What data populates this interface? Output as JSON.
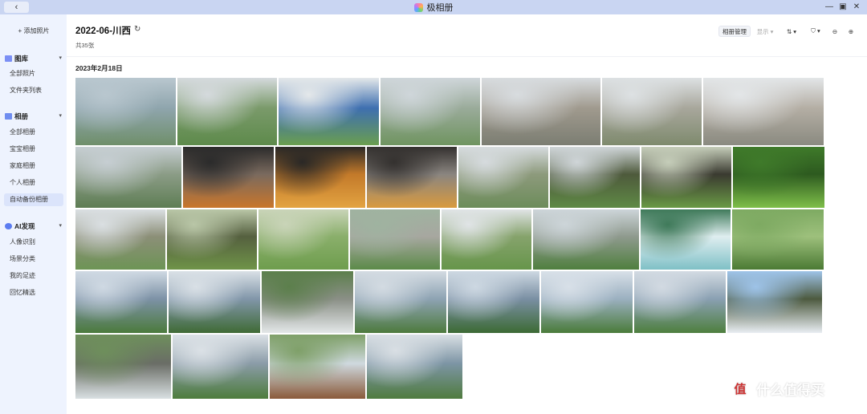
{
  "window": {
    "title": "极相册",
    "back_label": "‹",
    "controls": [
      "—",
      "▣",
      "✕"
    ]
  },
  "sidebar": {
    "add_photo": "+ 添加照片",
    "library": {
      "title": "图库",
      "items": [
        "全部照片",
        "文件夹列表"
      ]
    },
    "albums": {
      "title": "相册",
      "items": [
        "全部相册",
        "宝宝相册",
        "家庭相册",
        "个人相册",
        "自动备份相册"
      ],
      "active_index": 4
    },
    "ai": {
      "title": "AI发现",
      "items": [
        "人像识别",
        "场景分类",
        "我的足迹",
        "回忆精选"
      ]
    },
    "colors": {
      "accent": "#5b7cf0",
      "active_bg": "#dbe4fb"
    }
  },
  "header": {
    "album_title": "2022-06-川西",
    "photo_count": "共35张",
    "toolbar": {
      "manage": "相册管理",
      "display": "显示 ▾",
      "sort": "⇅ ▾",
      "filter": "⛉ ▾",
      "zoom_out": "⊖",
      "zoom_in": "⊕"
    }
  },
  "date_group": "2023年2月18日",
  "photos": [
    {
      "scene": "hydropower station under misty mountains by a lake",
      "colors": [
        "#b9c7cf",
        "#6f8f6a",
        "#8fa5ad"
      ]
    },
    {
      "scene": "green valley with village and clouds",
      "colors": [
        "#d5dadd",
        "#5d8a4b",
        "#7a9a6a"
      ]
    },
    {
      "scene": "meadow with blue signboard",
      "colors": [
        "#e4e8ea",
        "#6a9e4f",
        "#3e6fb0"
      ]
    },
    {
      "scene": "valley road and river with low clouds",
      "colors": [
        "#cfd6da",
        "#6f9460",
        "#9aab9a"
      ]
    },
    {
      "scene": "mountain ridges with swirling clouds",
      "colors": [
        "#d8dcdf",
        "#7b7d72",
        "#a09a8e"
      ]
    },
    {
      "scene": "winding mountain road in mist",
      "colors": [
        "#dde1e3",
        "#7e8a6d",
        "#a8a79c"
      ]
    },
    {
      "scene": "snow dusted peaks above clouds",
      "colors": [
        "#e3e6e8",
        "#8a8a80",
        "#b4aea4"
      ]
    },
    {
      "scene": "deep valley with cloud bank",
      "colors": [
        "#c6ced2",
        "#5e7d54",
        "#8b9c86"
      ]
    },
    {
      "scene": "grilled meat skewers on a grill",
      "colors": [
        "#2b2b2b",
        "#c9762b",
        "#7a6a5e"
      ]
    },
    {
      "scene": "fried potato skewers",
      "colors": [
        "#2a2826",
        "#e3a341",
        "#c37a2a"
      ]
    },
    {
      "scene": "skewers with fried dough",
      "colors": [
        "#34312f",
        "#d99a3e",
        "#8a8580"
      ]
    },
    {
      "scene": "grassy hillside under cloudy sky",
      "colors": [
        "#d6dbde",
        "#6c8c5a",
        "#8d9a7c"
      ]
    },
    {
      "scene": "yaks grazing on mountain slope",
      "colors": [
        "#cfd5d8",
        "#5f8a45",
        "#4e5a3c"
      ]
    },
    {
      "scene": "yaks on green pasture",
      "colors": [
        "#c5cdb9",
        "#6a9a45",
        "#3a3a30"
      ]
    },
    {
      "scene": "close up of green leafy plant",
      "colors": [
        "#3f7a2a",
        "#7fbf4a",
        "#2d5a1f"
      ]
    },
    {
      "scene": "wide valley with village below mountains",
      "colors": [
        "#dadfe2",
        "#6d9455",
        "#8c8f78"
      ]
    },
    {
      "scene": "grassland with grazing animals",
      "colors": [
        "#b9c6a7",
        "#6f9448",
        "#55603f"
      ]
    },
    {
      "scene": "terraced green fields",
      "colors": [
        "#c9d4b8",
        "#6e9d4d",
        "#8aaf6b"
      ]
    },
    {
      "scene": "town in a green valley from above",
      "colors": [
        "#9fb3a0",
        "#5b8a48",
        "#a7a7a0"
      ]
    },
    {
      "scene": "valley meadow under overcast sky",
      "colors": [
        "#e0e4e6",
        "#66954a",
        "#86a36c"
      ]
    },
    {
      "scene": "river valley between steep slopes",
      "colors": [
        "#cdd5d9",
        "#4f7f3e",
        "#8f9a8e"
      ]
    },
    {
      "scene": "turquoise mountain river",
      "colors": [
        "#3f7a5a",
        "#7fc0c6",
        "#dfeef0"
      ]
    },
    {
      "scene": "green riverside with trees",
      "colors": [
        "#7eaa62",
        "#4b7a34",
        "#9dc07c"
      ]
    },
    {
      "scene": "mountain lake with peaks",
      "colors": [
        "#cfd9e3",
        "#4b7a3c",
        "#7d92a6"
      ]
    },
    {
      "scene": "snowy peaks and pine forest",
      "colors": [
        "#d9e0e6",
        "#3f6a35",
        "#8196a9"
      ]
    },
    {
      "scene": "rapids flowing over rocks",
      "colors": [
        "#5c7f4c",
        "#e3e7e8",
        "#8a8f86"
      ]
    },
    {
      "scene": "alpine lake shore",
      "colors": [
        "#d3dbe2",
        "#4d7a3d",
        "#8ea3b3"
      ]
    },
    {
      "scene": "pines before snowy mountain",
      "colors": [
        "#cdd8e2",
        "#3c6a34",
        "#7a8fa3"
      ]
    },
    {
      "scene": "mountain reflection in lake",
      "colors": [
        "#d8e0e8",
        "#4a7b3a",
        "#9bb0c0"
      ]
    },
    {
      "scene": "valley with lake and trees",
      "colors": [
        "#d2dae2",
        "#4e7f3e",
        "#8aa0b2"
      ]
    },
    {
      "scene": "tree branches against blue sky",
      "colors": [
        "#9ec3e8",
        "#e9eef3",
        "#4d5a3f"
      ]
    },
    {
      "scene": "waterfall cascade with sign",
      "colors": [
        "#6e8f5c",
        "#d9e0e2",
        "#6a6d66"
      ]
    },
    {
      "scene": "mountain valley and riverbank",
      "colors": [
        "#dbe1e6",
        "#4d7c3c",
        "#8b9ca8"
      ]
    },
    {
      "scene": "wooden pavilion by stream",
      "colors": [
        "#7fa069",
        "#8a5a3a",
        "#cfd9df"
      ]
    },
    {
      "scene": "lake with dead trees and mountains",
      "colors": [
        "#d9dfe4",
        "#4f7b3e",
        "#7d95a5"
      ]
    }
  ],
  "watermark": {
    "logo": "值",
    "text": "什么值得买"
  }
}
